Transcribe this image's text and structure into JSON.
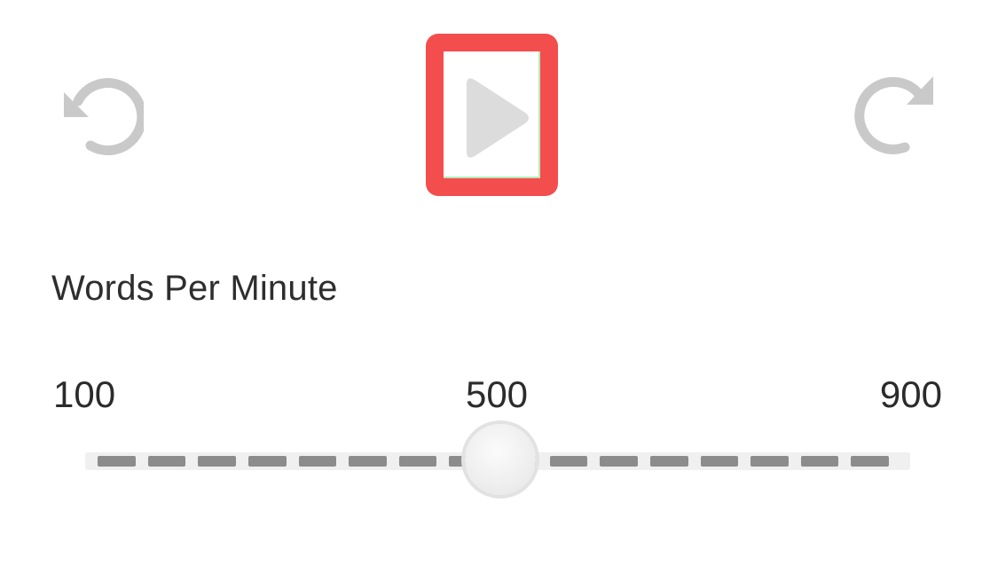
{
  "controls": {
    "rewind_icon": "rotate-ccw-icon",
    "play_icon": "play-icon",
    "forward_icon": "rotate-cw-icon",
    "icon_color": "#c9c9c9",
    "highlight_color": "#f44d4d"
  },
  "speed": {
    "label": "Words Per Minute",
    "min_label": "100",
    "mid_label": "500",
    "max_label": "900",
    "min": 100,
    "max": 900,
    "value": 500,
    "segment_count": 16
  }
}
